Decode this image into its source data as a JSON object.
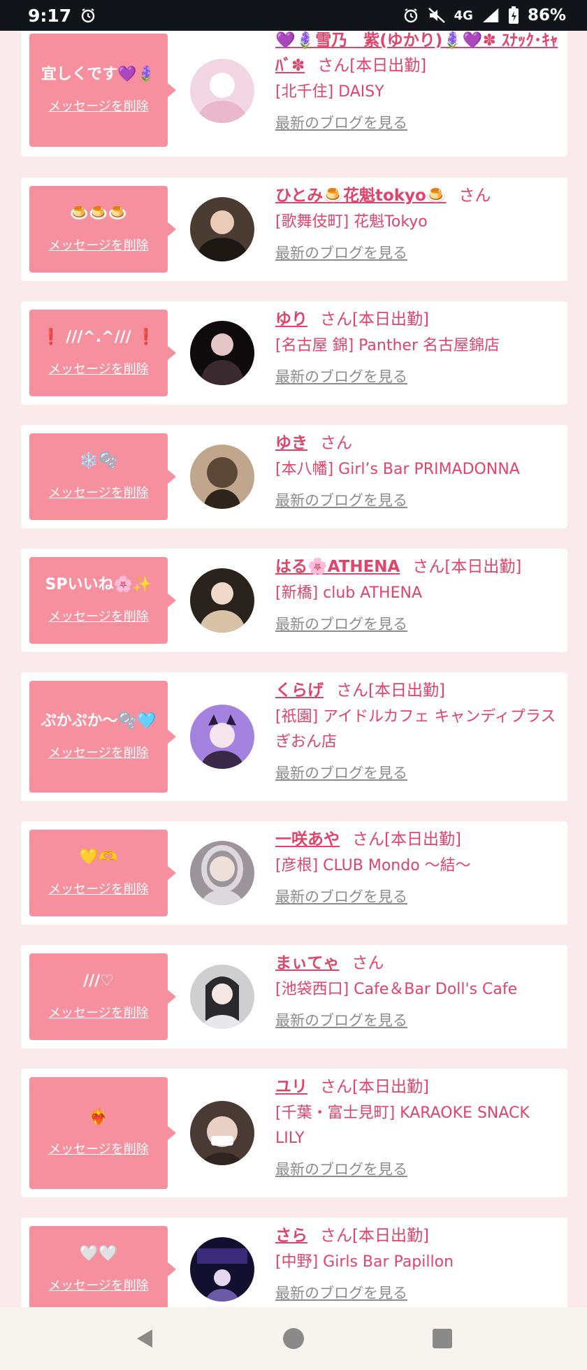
{
  "status_bar": {
    "time": "9:17",
    "network": "4G",
    "battery": "86%",
    "icons": [
      "alarm-icon",
      "alarm-icon",
      "mute-icon",
      "signal-icon",
      "battery-icon"
    ]
  },
  "common": {
    "delete_label": "メッセージを削除",
    "blog_label": "最新のブログを見る"
  },
  "items": [
    {
      "message": "宜しくです💜🪻",
      "name": "💜🪻雪乃　紫(ゆかり)🪻💜✽ ｽﾅｯｸ･ｷｬﾊﾞ✽",
      "suffix": "さん[本日出勤]",
      "shop": "[北千住] DAISY",
      "avatar_colors": [
        "#f3d6e4",
        "#ffffff"
      ]
    },
    {
      "message": "🍮🍮🍮",
      "name": "ひとみ🍮花魁tokyo🍮",
      "suffix": "さん",
      "shop": "[歌舞伎町] 花魁Tokyo",
      "avatar_colors": [
        "#4a3b33",
        "#1e1814"
      ]
    },
    {
      "message": "❗ ///^.^/// ❗",
      "name": "ゆり",
      "suffix": "さん[本日出勤]",
      "shop": "[名古屋 錦] Panther 名古屋錦店",
      "avatar_colors": [
        "#3a2a30",
        "#0f0a0c"
      ]
    },
    {
      "message": "❄️🫧",
      "name": "ゆき",
      "suffix": "さん",
      "shop": "[本八幡] Girl’s Bar PRIMADONNA",
      "avatar_colors": [
        "#bfa68c",
        "#5a4738"
      ]
    },
    {
      "message": "SPいいね🌸✨",
      "name": "はる🌸ATHENA",
      "suffix": "さん[本日出勤]",
      "shop": "[新橋] club ATHENA",
      "avatar_colors": [
        "#5a4a3e",
        "#2a221c"
      ]
    },
    {
      "message": "ぷかぷか〜🫧🩵",
      "name": "くらげ",
      "suffix": "さん[本日出勤]",
      "shop": "[祇園] アイドルカフェ キャンディプラス ぎおん店",
      "avatar_colors": [
        "#d8c6f4",
        "#a483e0"
      ]
    },
    {
      "message": "💛🫶",
      "name": "一咲あや",
      "suffix": "さん[本日出勤]",
      "shop": "[彦根] CLUB Mondo 〜結〜",
      "avatar_colors": [
        "#dcd8dc",
        "#9b949a"
      ]
    },
    {
      "message": "///♡",
      "name": "まぃてゃ",
      "suffix": "さん",
      "shop": "[池袋西口] Cafe＆Bar Doll's Cafe",
      "avatar_colors": [
        "#cfcfcf",
        "#2a2a2e"
      ]
    },
    {
      "message": "❤️‍🔥",
      "name": "ユリ",
      "suffix": "さん[本日出勤]",
      "shop": "[千葉・富士見町] KARAOKE SNACK LILY",
      "avatar_colors": [
        "#e8d0c6",
        "#4a3a36"
      ]
    },
    {
      "message": "🤍🤍",
      "name": "さら",
      "suffix": "さん[本日出勤]",
      "shop": "[中野] Girls Bar Papillon",
      "avatar_colors": [
        "#3a2a7a",
        "#12102e"
      ]
    }
  ]
}
